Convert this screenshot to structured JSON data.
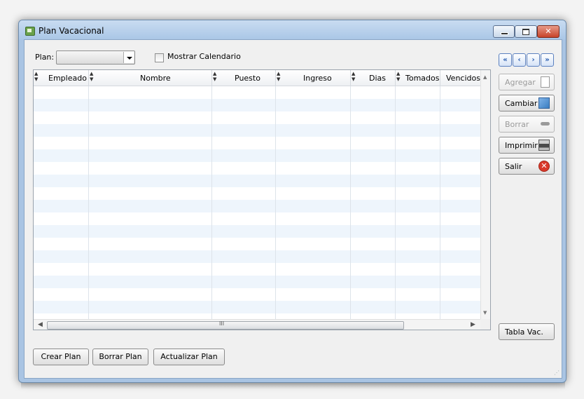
{
  "window": {
    "title": "Plan Vacacional",
    "icon": "app-window-icon",
    "controls": {
      "minimize": "minimize-icon",
      "maximize": "maximize-icon",
      "close": "✕"
    }
  },
  "toolbar": {
    "plan_label": "Plan:",
    "plan_value": "",
    "show_calendar_label": "Mostrar Calendario",
    "show_calendar_checked": false
  },
  "table": {
    "columns": [
      "Empleado",
      "Nombre",
      "Puesto",
      "Ingreso",
      "Dias",
      "Tomados",
      "Vencidos"
    ],
    "rows": [],
    "hscroll_label": "III"
  },
  "navigation": {
    "first": "«",
    "previous": "‹",
    "next": "›",
    "last": "»"
  },
  "actions": {
    "add": {
      "label": "Agregar",
      "enabled": false,
      "icon": "new-page-icon"
    },
    "change": {
      "label": "Cambiar",
      "enabled": true,
      "icon": "picture-icon"
    },
    "delete": {
      "label": "Borrar",
      "enabled": false,
      "icon": "minus-icon"
    },
    "print": {
      "label": "Imprimir",
      "enabled": true,
      "icon": "printer-icon"
    },
    "exit": {
      "label": "Salir",
      "enabled": true,
      "icon": "close-circle-icon",
      "icon_glyph": "✕"
    },
    "table_vac": {
      "label": "Tabla Vac."
    }
  },
  "bottom_buttons": {
    "create_plan": "Crear Plan",
    "delete_plan": "Borrar Plan",
    "update_plan": "Actualizar Plan"
  },
  "colors": {
    "title_bar": "#b6cfea",
    "alt_row": "#eef5fc",
    "close_button": "#c7432a"
  }
}
